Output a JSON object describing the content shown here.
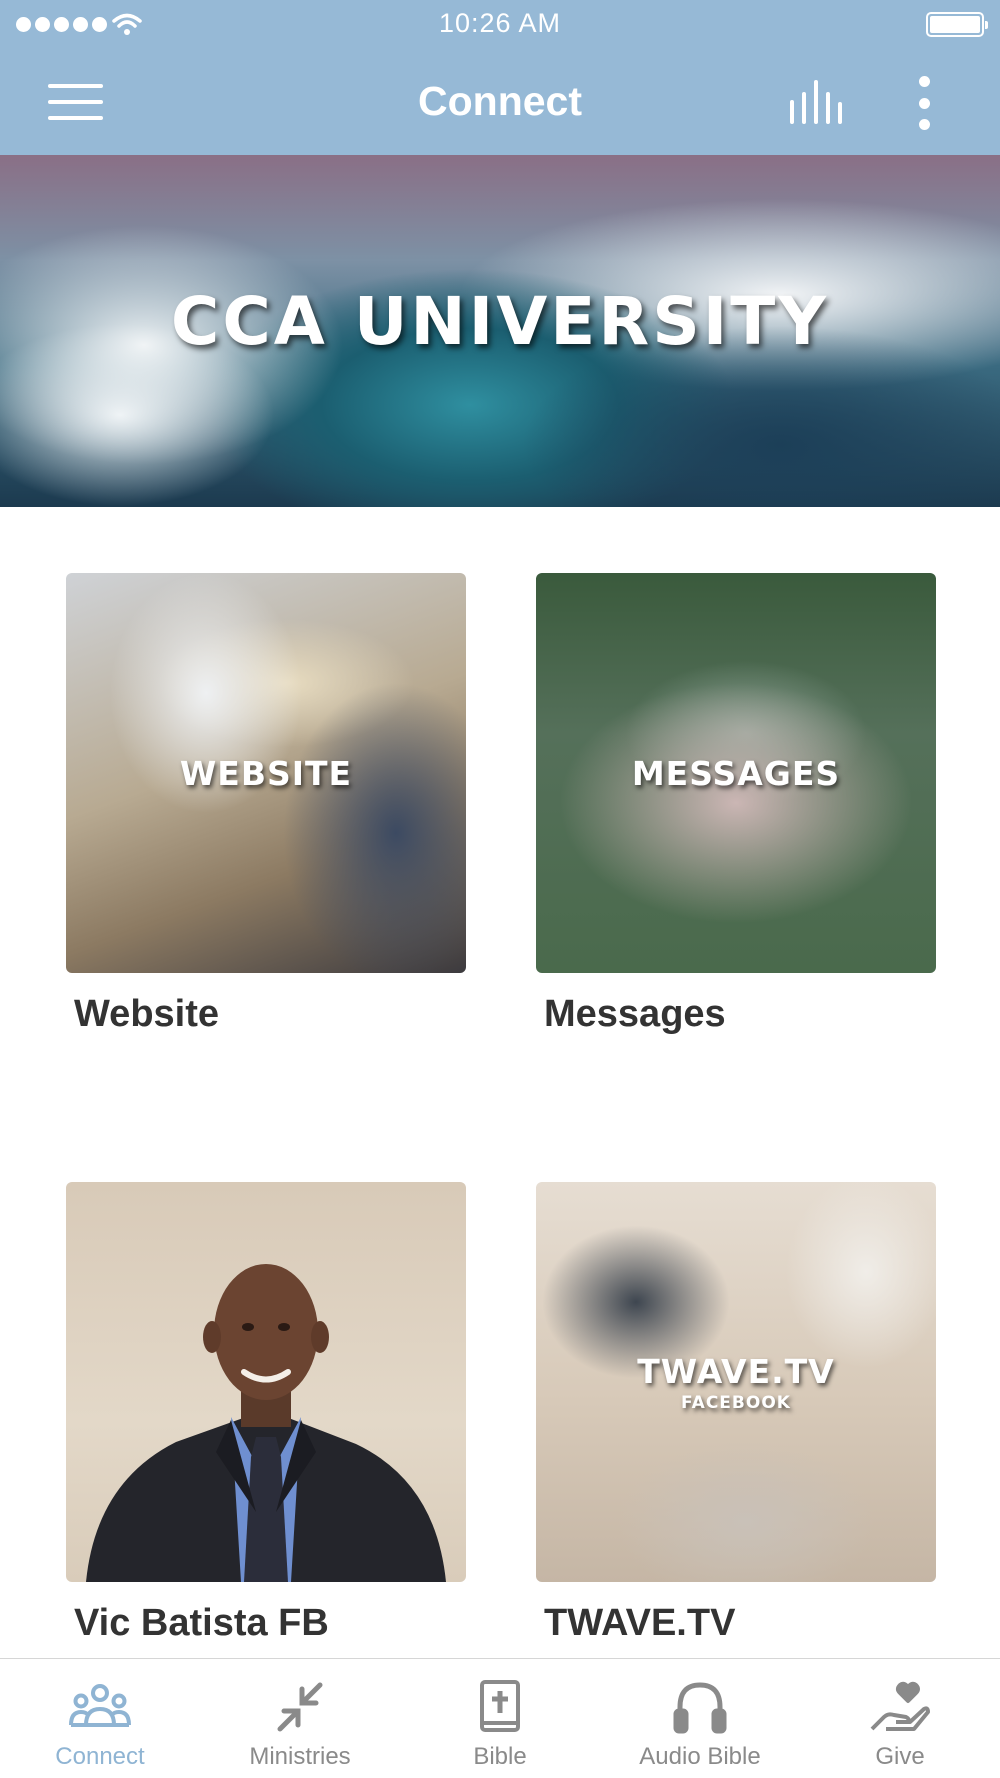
{
  "status_bar": {
    "time": "10:26 AM"
  },
  "nav": {
    "title": "Connect"
  },
  "banner": {
    "title": "CCA UNIVERSITY"
  },
  "tiles": [
    {
      "overlay": "WEBSITE",
      "overlay_sub": "",
      "label": "Website"
    },
    {
      "overlay": "MESSAGES",
      "overlay_sub": "",
      "label": "Messages"
    },
    {
      "overlay": "",
      "overlay_sub": "",
      "label": "Vic Batista FB"
    },
    {
      "overlay": "TWAVE.TV",
      "overlay_sub": "FACEBOOK",
      "label": "TWAVE.TV"
    }
  ],
  "tab_bar": {
    "active_color": "#8fb4d3",
    "inactive_color": "#8a8a8a",
    "items": [
      {
        "label": "Connect",
        "icon": "people-group-icon",
        "active": true
      },
      {
        "label": "Ministries",
        "icon": "arrows-inward-icon",
        "active": false
      },
      {
        "label": "Bible",
        "icon": "bible-book-icon",
        "active": false
      },
      {
        "label": "Audio Bible",
        "icon": "headphones-icon",
        "active": false
      },
      {
        "label": "Give",
        "icon": "hand-heart-icon",
        "active": false
      }
    ]
  },
  "colors": {
    "header_bg": "#96b9d6",
    "tile_label": "#333333"
  }
}
